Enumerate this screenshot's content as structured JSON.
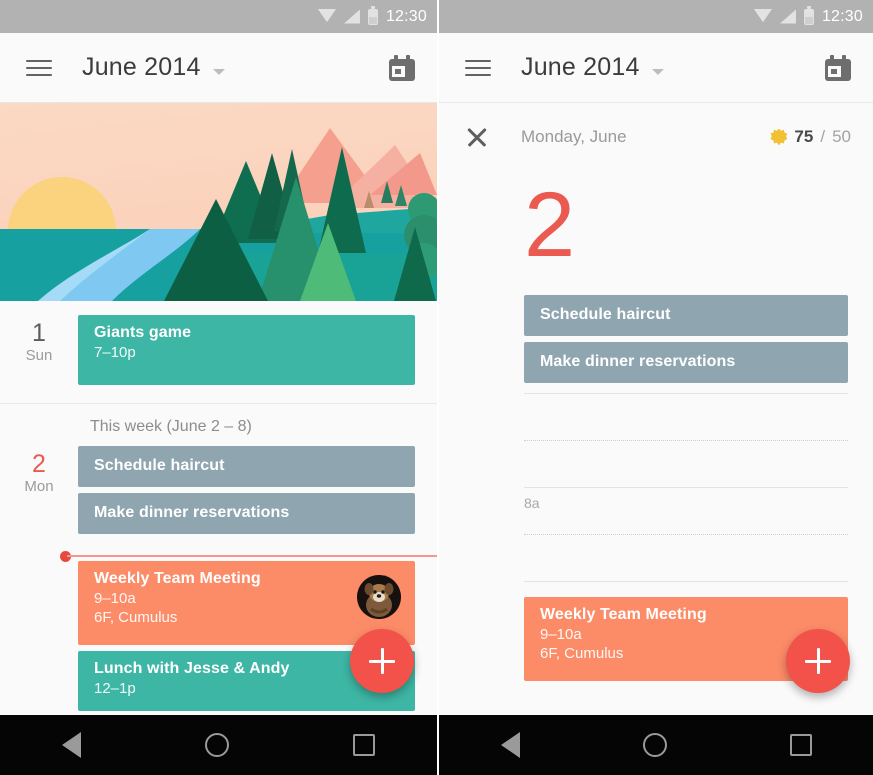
{
  "statusbar": {
    "clock": "12:30",
    "icons": [
      "wifi-icon",
      "signal-icon",
      "battery-icon"
    ]
  },
  "appbar": {
    "menu_icon": "hamburger-menu-icon",
    "title": "June 2014",
    "dropdown_icon": "chevron-down-icon",
    "calendar_icon": "calendar-icon"
  },
  "colors": {
    "accent_red": "#f25249",
    "today_red": "#ea5a51",
    "event_teal": "#3eb6a5",
    "event_orange": "#fc8b68",
    "task_gray": "#8fa6b0",
    "statusbar_gray": "#b2b2b2",
    "weather_yellow": "#f2c033"
  },
  "hero": {
    "name": "month-illustration-june",
    "description": "flat landscape illustration: sunrise over lake with pine forest and pink mountains"
  },
  "left_panel": {
    "week_label": "This week (June 2 – 8)",
    "days": [
      {
        "date_num": "1",
        "day_name": "Sun",
        "is_today": false,
        "items": [
          {
            "kind": "event",
            "title": "Giants game",
            "time": "7–10p",
            "location": "",
            "color": "#3eb6a5"
          }
        ]
      },
      {
        "date_num": "2",
        "day_name": "Mon",
        "is_today": true,
        "items": [
          {
            "kind": "task",
            "title": "Schedule haircut",
            "color": "#8fa6b0"
          },
          {
            "kind": "task",
            "title": "Make dinner reservations",
            "color": "#8fa6b0"
          },
          {
            "kind": "nowline"
          },
          {
            "kind": "event",
            "title": "Weekly Team Meeting",
            "time": "9–10a",
            "location": "6F, Cumulus",
            "color": "#fc8b68",
            "avatar": "attendee-avatar"
          },
          {
            "kind": "event",
            "title": "Lunch with Jesse & Andy",
            "time": "12–1p",
            "location": "",
            "color": "#3eb6a5"
          }
        ]
      }
    ]
  },
  "right_panel": {
    "close_icon": "close-icon",
    "header_label": "Monday, June",
    "weather": {
      "icon": "sun-icon",
      "high": "75",
      "separator": "/",
      "low": "50"
    },
    "big_date": "2",
    "tasks": [
      {
        "title": "Schedule haircut",
        "color": "#8fa6b0"
      },
      {
        "title": "Make dinner reservations",
        "color": "#8fa6b0"
      }
    ],
    "timeline": [
      {
        "style": "solid",
        "time": ""
      },
      {
        "style": "dotted",
        "time": ""
      },
      {
        "style": "solid",
        "time": "8a"
      },
      {
        "style": "dotted",
        "time": ""
      },
      {
        "style": "solid",
        "time": ""
      }
    ],
    "event": {
      "title": "Weekly Team Meeting",
      "time": "9–10a",
      "location": "6F, Cumulus",
      "color": "#fc8b68"
    }
  },
  "fab": {
    "label": "+",
    "name": "add-event-fab"
  },
  "navbar": {
    "back": "back-icon",
    "home": "home-icon",
    "recents": "recents-icon"
  }
}
